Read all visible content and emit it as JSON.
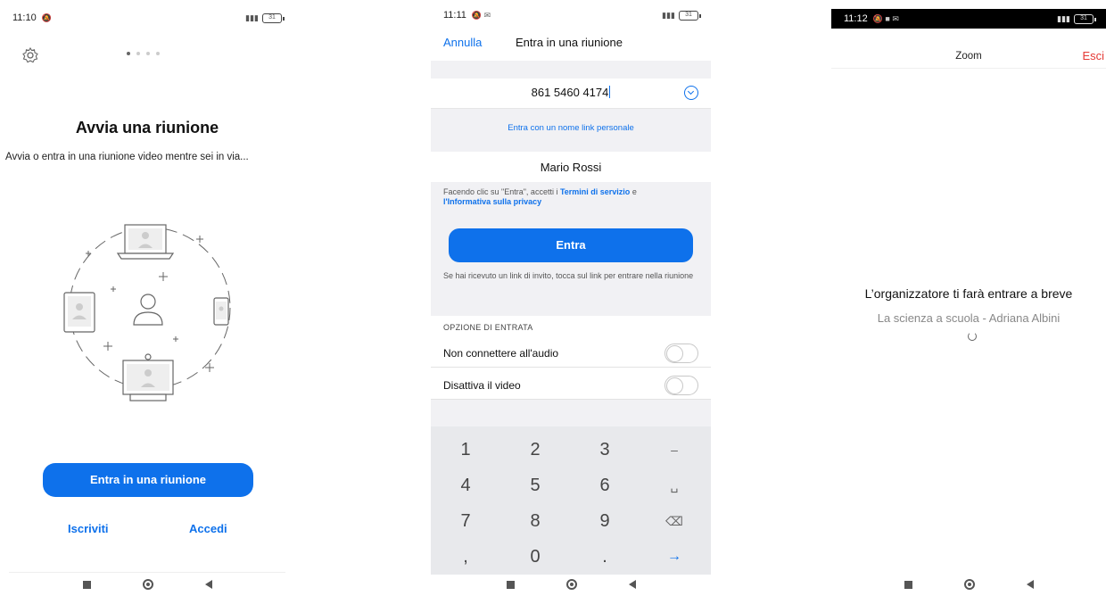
{
  "panel1": {
    "status": {
      "time": "11:10",
      "battery": "31"
    },
    "title": "Avvia una riunione",
    "subtitle": "Avvia o entra in una riunione video mentre sei in via...",
    "join_button": "Entra in una riunione",
    "sign_up": "Iscriviti",
    "sign_in": "Accedi"
  },
  "panel2": {
    "status": {
      "time": "11:11",
      "battery": "31"
    },
    "cancel": "Annulla",
    "title": "Entra in una riunione",
    "meeting_id": "861 5460 4174",
    "personal_link": "Entra con un nome link personale",
    "name": "Mario Rossi",
    "terms_prefix": "Facendo clic su \"Entra\", accetti i ",
    "terms_link": "Termini di servizio",
    "terms_mid": " e ",
    "privacy_link": "l'Informativa sulla privacy",
    "join_button": "Entra",
    "invite_hint": "Se hai ricevuto un link di invito, tocca sul link per entrare nella riunione",
    "options_header": "OPZIONE DI ENTRATA",
    "opt_audio": "Non connettere all'audio",
    "opt_video": "Disattiva il video",
    "keys": [
      "1",
      "2",
      "3",
      "–",
      "4",
      "5",
      "6",
      "␣",
      "7",
      "8",
      "9",
      "⌫",
      ",",
      "0",
      ".",
      "→"
    ]
  },
  "panel3": {
    "status": {
      "time": "11:12",
      "battery": "31"
    },
    "title": "Zoom",
    "exit": "Esci",
    "message": "L’organizzatore ti farà entrare a breve",
    "meeting_name": "La scienza a scuola - Adriana Albini"
  },
  "colors": {
    "accent": "#0E71EB",
    "exit": "#e53935"
  }
}
